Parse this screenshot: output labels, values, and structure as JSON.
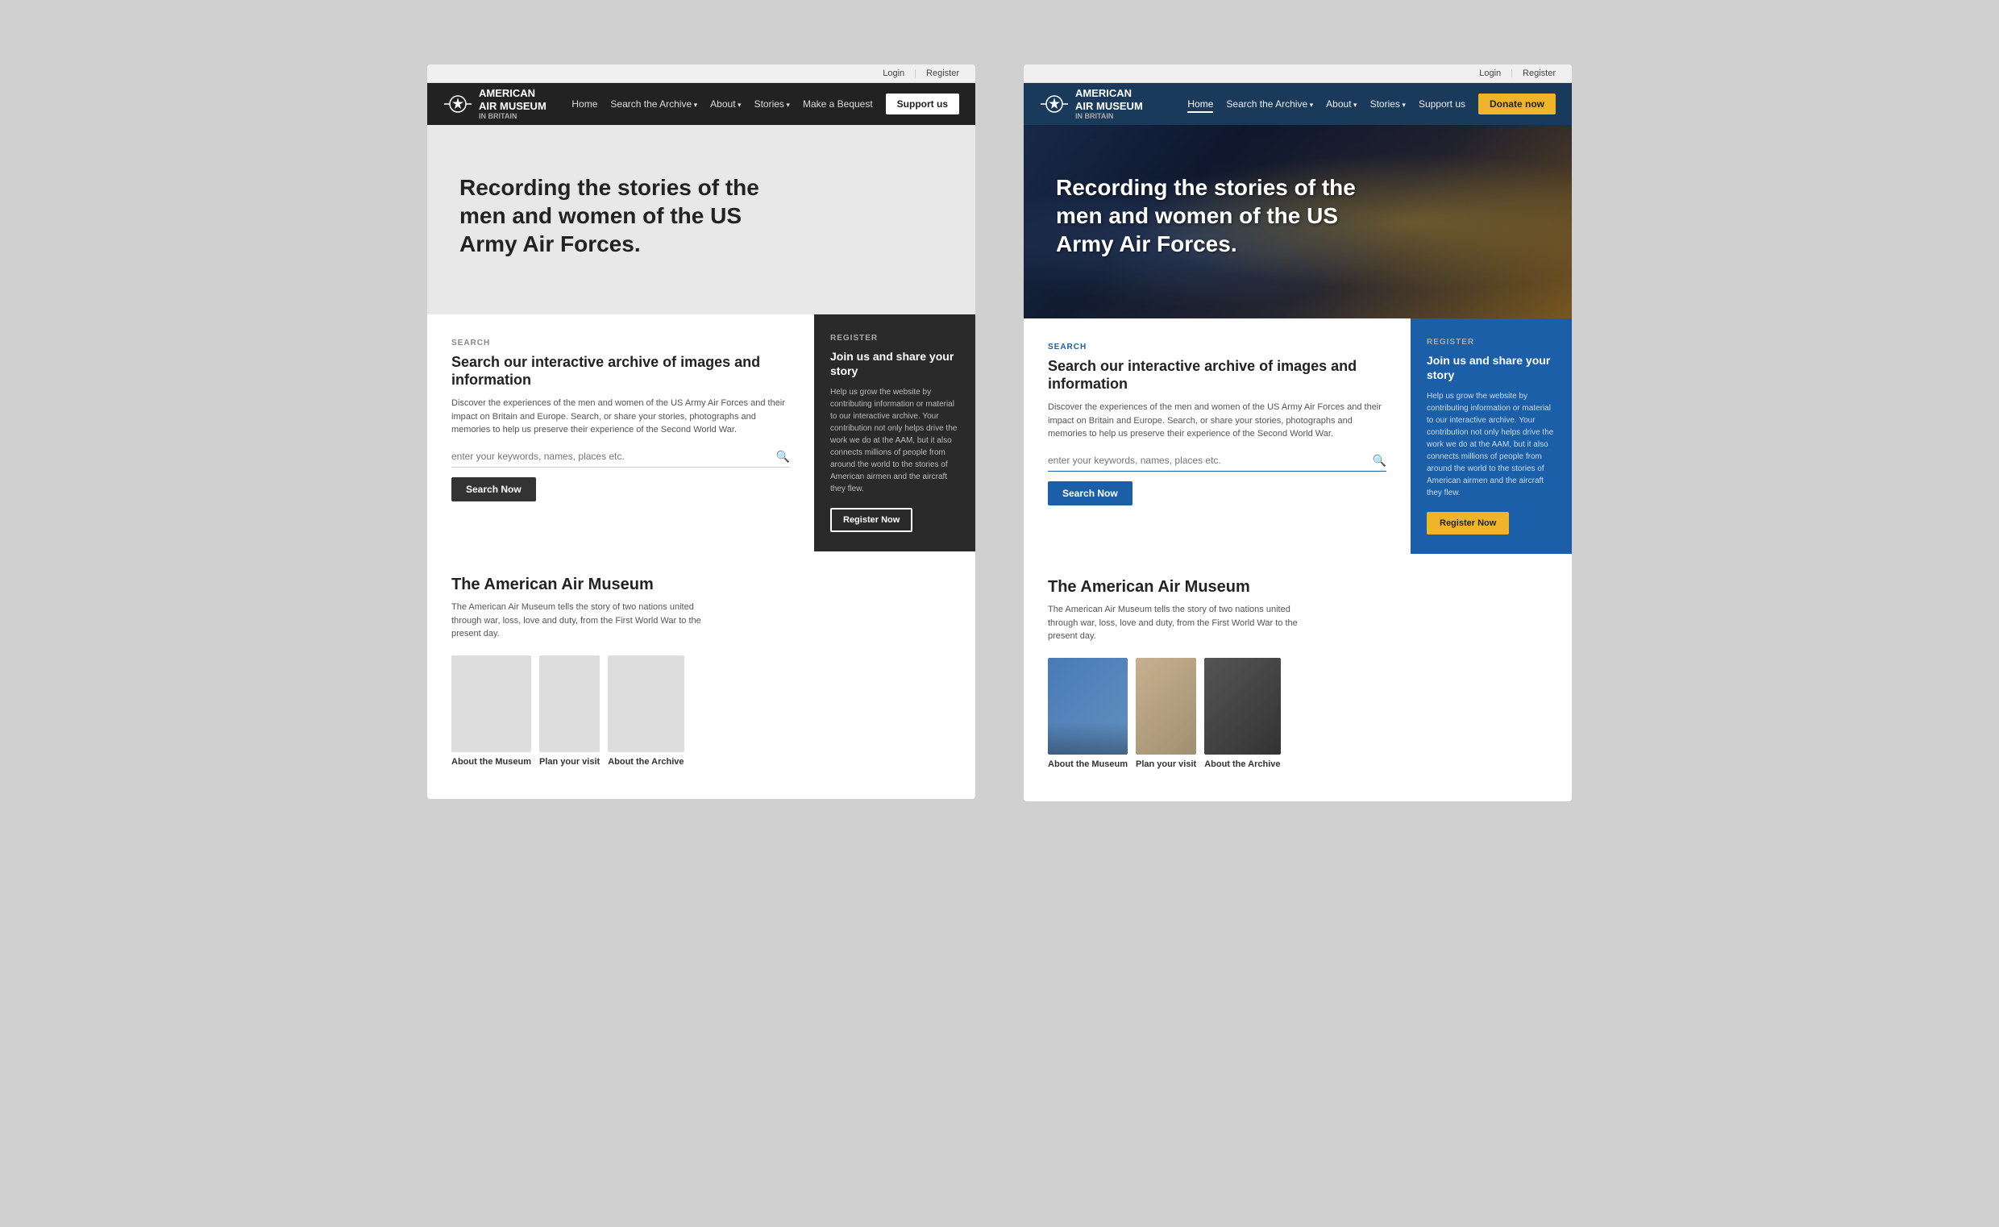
{
  "left": {
    "auth": {
      "login": "Login",
      "register": "Register"
    },
    "nav": {
      "logo_line1": "AMERICAN",
      "logo_line2": "AIR MUSEUM",
      "logo_line3": "IN BRITAIN",
      "links": [
        {
          "label": "Home",
          "dropdown": false
        },
        {
          "label": "Search the Archive",
          "dropdown": true
        },
        {
          "label": "About",
          "dropdown": true
        },
        {
          "label": "Stories",
          "dropdown": true
        },
        {
          "label": "Make a Bequest",
          "dropdown": false
        }
      ],
      "support_button": "Support us"
    },
    "hero": {
      "title": "Recording the stories of the men and women of the US Army Air Forces."
    },
    "search": {
      "label": "SEARCH",
      "heading": "Search our interactive archive of images and information",
      "description": "Discover the experiences of the men and women of the US Army Air Forces and their impact on Britain and Europe. Search, or share your stories, photographs and memories to help us preserve their experience of the Second World War.",
      "input_placeholder": "enter your keywords, names, places etc.",
      "button": "Search Now"
    },
    "register": {
      "label": "REGISTER",
      "heading": "Join us and share your story",
      "description": "Help us grow the website by contributing information or material to our interactive archive. Your contribution not only helps drive the work we do at the AAM, but it also connects millions of people from around the world to the stories of American airmen and the aircraft they flew.",
      "button": "Register Now"
    },
    "museum": {
      "heading": "The American Air Museum",
      "description": "The American Air Museum tells the story of two nations united through war, loss, love and duty, from the First World War to the present day.",
      "cards": [
        {
          "label": "About the Museum"
        },
        {
          "label": "Plan your visit"
        },
        {
          "label": "About the Archive"
        }
      ]
    }
  },
  "right": {
    "auth": {
      "login": "Login",
      "register": "Register"
    },
    "nav": {
      "logo_line1": "AMERICAN",
      "logo_line2": "AIR MUSEUM",
      "logo_line3": "IN BRITAIN",
      "links": [
        {
          "label": "Home",
          "active": true
        },
        {
          "label": "Search the Archive",
          "dropdown": true
        },
        {
          "label": "About",
          "dropdown": true
        },
        {
          "label": "Stories",
          "dropdown": true
        },
        {
          "label": "Support us"
        }
      ],
      "donate_button": "Donate now"
    },
    "hero": {
      "title": "Recording the stories of the men and women of the US Army Air Forces."
    },
    "search": {
      "label": "SEARCH",
      "heading": "Search our interactive archive of images and information",
      "description": "Discover the experiences of the men and women of the US Army Air Forces and their impact on Britain and Europe. Search, or share your stories, photographs and memories to help us preserve their experience of the Second World War.",
      "input_placeholder": "enter your keywords, names, places etc.",
      "button": "Search Now"
    },
    "register": {
      "label": "REGISTER",
      "heading": "Join us and share your story",
      "description": "Help us grow the website by contributing information or material to our interactive archive. Your contribution not only helps drive the work we do at the AAM, but it also connects millions of people from around the world to the stories of American airmen and the aircraft they flew.",
      "button": "Register Now"
    },
    "museum": {
      "heading": "The American Air Museum",
      "description": "The American Air Museum tells the story of two nations united through war, loss, love and duty, from the First World War to the present day.",
      "cards": [
        {
          "label": "About the Museum"
        },
        {
          "label": "Plan your visit"
        },
        {
          "label": "About the Archive"
        }
      ]
    }
  }
}
